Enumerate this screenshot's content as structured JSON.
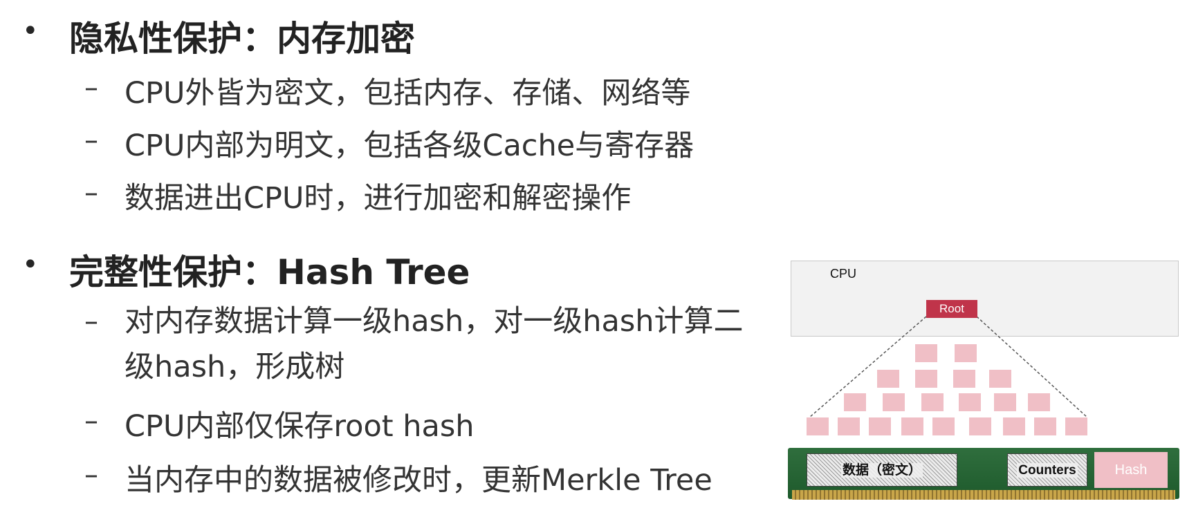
{
  "section1": {
    "bullet": "•",
    "title": "隐私性保护：内存加密",
    "items": [
      "CPU外皆为密文，包括内存、存储、网络等",
      "CPU内部为明文，包括各级Cache与寄存器",
      "数据进出CPU时，进行加密和解密操作"
    ]
  },
  "section2": {
    "bullet": "•",
    "title": "完整性保护：Hash Tree",
    "items": [
      "对内存数据计算一级hash，对一级hash计算二级hash，形成树",
      "CPU内部仅保存root hash",
      "当内存中的数据被修改时，更新Merkle Tree"
    ]
  },
  "dash": "–",
  "diagram": {
    "cpu_label": "CPU",
    "root_label": "Root",
    "data_label": "数据（密文）",
    "counters_label": "Counters",
    "hash_label": "Hash",
    "colors": {
      "root": "#c0344a",
      "node": "#f0bfc6",
      "cpu_box": "#f2f2f2",
      "board": "#2f6e3d"
    }
  }
}
